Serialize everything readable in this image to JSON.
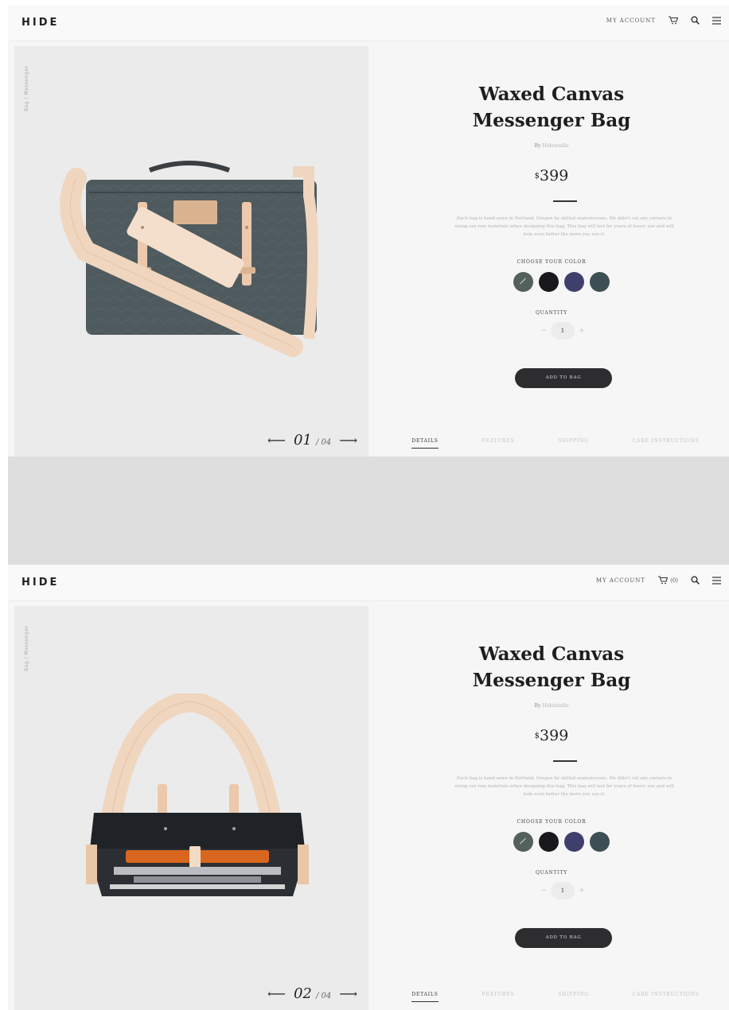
{
  "brand": "HIDE",
  "nav": {
    "account_label": "MY ACCOUNT",
    "cart_count": "(0)"
  },
  "product": {
    "title_line1": "Waxed Canvas",
    "title_line2": "Messenger Bag",
    "by_label": "By",
    "author": "Hidestudio",
    "currency": "$",
    "price": "399",
    "description": "Each bag is hand sewn in Portland, Oregon by skilled seamstresses. We didn't cut any corners in sizing our raw materials when designing this bag. This bag will last for years of heavy use and will look even better the more you use it.",
    "breadcrumb": "Bag / Messenger",
    "color_label": "CHOOSE YOUR COLOR",
    "colors": [
      {
        "name": "slate",
        "hex": "#54605b",
        "selected": true
      },
      {
        "name": "black",
        "hex": "#19191c",
        "selected": false
      },
      {
        "name": "navy",
        "hex": "#3e3f6b",
        "selected": false
      },
      {
        "name": "teal-gray",
        "hex": "#3d4e55",
        "selected": false
      }
    ],
    "quantity_label": "QUANTITY",
    "quantity": "1",
    "decrement": "−",
    "increment": "+",
    "add_to_bag": "ADD TO BAG"
  },
  "tabs": [
    "DETAILS",
    "FEATURES",
    "SHIPPING",
    "CARE INSTRUCTIONS"
  ],
  "slides": [
    {
      "current": "01",
      "total": "/ 04"
    },
    {
      "current": "02",
      "total": "/ 04"
    }
  ]
}
